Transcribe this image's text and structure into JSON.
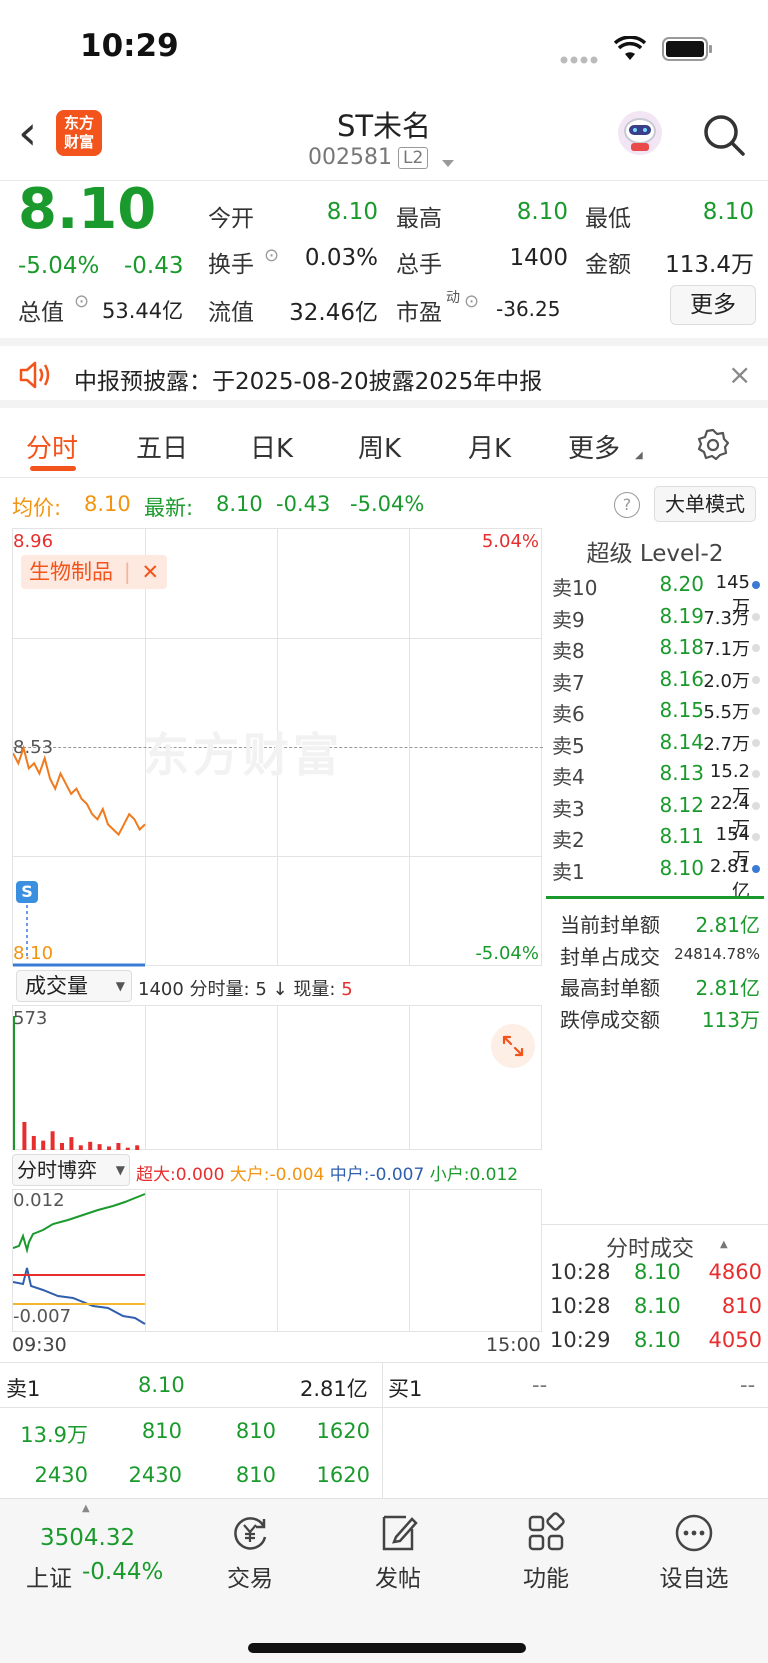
{
  "status": {
    "time": "10:29"
  },
  "nav": {
    "back": "‹",
    "logo_line1": "东方",
    "logo_line2": "财富",
    "title": "ST未名",
    "code": "002581",
    "level_badge": "L2"
  },
  "quote": {
    "price": "8.10",
    "change_pct": "-5.04%",
    "change": "-0.43",
    "open_label": "今开",
    "open": "8.10",
    "high_label": "最高",
    "high": "8.10",
    "low_label": "最低",
    "low": "8.10",
    "turnover_label": "换手",
    "turnover": "0.03%",
    "volume_label": "总手",
    "volume": "1400",
    "amount_label": "金额",
    "amount": "113.4万",
    "mktcap_label": "总值",
    "mktcap": "53.44亿",
    "float_label": "流值",
    "float": "32.46亿",
    "pe_label": "市盈",
    "pe_sup": "动",
    "pe": "-36.25",
    "more_button": "更多"
  },
  "notice": {
    "text": "中报预披露：于2025-08-20披露2025年中报",
    "close": "×"
  },
  "tabs": [
    "分时",
    "五日",
    "日K",
    "周K",
    "月K",
    "更多"
  ],
  "avg": {
    "label": "均价:",
    "value": "8.10",
    "latest_label": "最新:",
    "latest": "8.10",
    "chg": "-0.43",
    "pct": "-5.04%",
    "mode_button": "大单模式"
  },
  "chart": {
    "y_top": "8.96",
    "y_mid": "8.53",
    "y_bottom": "8.10",
    "pct_top": "5.04%",
    "pct_bottom": "-5.04%",
    "sector_tag": "生物制品",
    "tag_close": "✕",
    "watermark": "东方财富",
    "s_marker": "S",
    "time_start": "09:30",
    "time_end": "15:00"
  },
  "chart_data": {
    "type": "line",
    "title": "",
    "series": [
      {
        "values": [
          8.52,
          8.5,
          8.53,
          8.49,
          8.5,
          8.48,
          8.51,
          8.47,
          8.45,
          8.48,
          8.46,
          8.44,
          8.45,
          8.43,
          8.42,
          8.4,
          8.39,
          8.41,
          8.38,
          8.37,
          8.36,
          8.38,
          8.4,
          8.39,
          8.37,
          8.38
        ]
      }
    ],
    "ylim": [
      8.1,
      8.96
    ],
    "volume": [
      573,
      120,
      60,
      40,
      80,
      30,
      55,
      20,
      35,
      25,
      15,
      30,
      10,
      20
    ],
    "volume_max": "573"
  },
  "volbar": {
    "select": "成交量",
    "total": "1400",
    "min_label": "分时量:",
    "min_val": "5",
    "arrow": "↓",
    "cur_label": "现量:",
    "cur_val": "5"
  },
  "flow": {
    "select": "分时博弈",
    "super_label": "超大:",
    "super": "0.000",
    "large_label": "大户:",
    "large": "-0.004",
    "mid_label": "中户:",
    "mid": "-0.007",
    "small_label": "小户:",
    "small": "0.012",
    "y_top": "0.012",
    "y_bottom": "-0.007"
  },
  "orderbook": {
    "title": "超级 Level-2",
    "rows": [
      {
        "name": "卖10",
        "price": "8.20",
        "qty": "145万"
      },
      {
        "name": "卖9",
        "price": "8.19",
        "qty": "7.3万"
      },
      {
        "name": "卖8",
        "price": "8.18",
        "qty": "7.1万"
      },
      {
        "name": "卖7",
        "price": "8.16",
        "qty": "2.0万"
      },
      {
        "name": "卖6",
        "price": "8.15",
        "qty": "5.5万"
      },
      {
        "name": "卖5",
        "price": "8.14",
        "qty": "2.7万"
      },
      {
        "name": "卖4",
        "price": "8.13",
        "qty": "15.2万"
      },
      {
        "name": "卖3",
        "price": "8.12",
        "qty": "22.4万"
      },
      {
        "name": "卖2",
        "price": "8.11",
        "qty": "154万"
      },
      {
        "name": "卖1",
        "price": "8.10",
        "qty": "2.81亿"
      }
    ],
    "summary": [
      {
        "label": "当前封单额",
        "value": "2.81亿"
      },
      {
        "label": "封单占成交",
        "value": "24814.78%"
      },
      {
        "label": "最高封单额",
        "value": "2.81亿"
      },
      {
        "label": "跌停成交额",
        "value": "113万"
      }
    ]
  },
  "trades": {
    "title": "分时成交",
    "rows": [
      {
        "time": "10:28",
        "price": "8.10",
        "vol": "4860"
      },
      {
        "time": "10:28",
        "price": "8.10",
        "vol": "810"
      },
      {
        "time": "10:29",
        "price": "8.10",
        "vol": "4050"
      }
    ]
  },
  "queue": {
    "sell_label": "卖1",
    "sell_price": "8.10",
    "sell_total": "2.81亿",
    "buy_label": "买1",
    "buy_price": "--",
    "buy_total": "--",
    "row1": [
      "13.9万",
      "810",
      "810",
      "1620"
    ],
    "row2": [
      "2430",
      "2430",
      "810",
      "1620"
    ]
  },
  "bottom": {
    "index_value": "3504.32",
    "index_name": "上证",
    "index_pct": "-0.44%",
    "items": [
      "交易",
      "发帖",
      "功能",
      "设自选"
    ]
  }
}
